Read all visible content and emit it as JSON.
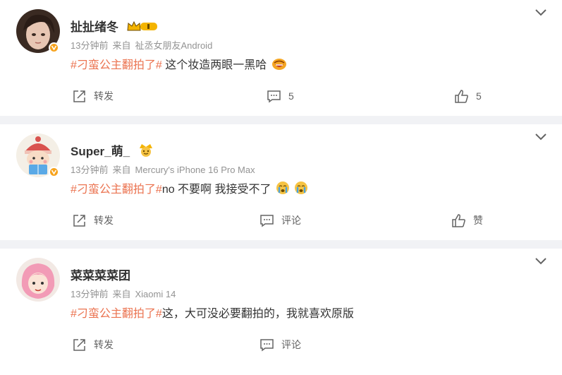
{
  "posts": [
    {
      "user": "扯扯绪冬",
      "time": "13分钟前",
      "source_prefix": "来自",
      "source": "祉丞女朋友Android",
      "hashtag": "#刁蛮公主翻拍了#",
      "text": " 这个妆造两眼一黑哈",
      "repost": "转发",
      "comments": "5",
      "likes": "5"
    },
    {
      "user": "Super_萌_",
      "time": "13分钟前",
      "source_prefix": "来自",
      "source": "Mercury's iPhone 16 Pro Max",
      "hashtag": "#刁蛮公主翻拍了#",
      "text": "no 不要啊 我接受不了",
      "repost": "转发",
      "comments": "评论",
      "likes": "赞"
    },
    {
      "user": "菜菜菜菜团",
      "time": "13分钟前",
      "source_prefix": "来自",
      "source": "Xiaomi 14",
      "hashtag": "#刁蛮公主翻拍了#",
      "text": "这，大可没必要翻拍的，我就喜欢原版",
      "repost": "转发",
      "comments": "评论"
    }
  ],
  "colors": {
    "hashtag": "#eb7350",
    "badge": "#f7a21b",
    "separator": "#f1f2f5"
  },
  "icons": [
    "chevron-down-icon",
    "repost-icon",
    "comment-icon",
    "like-icon",
    "verified-badge-icon",
    "crown-badge-icon",
    "laugh-emoji-icon",
    "crying-emoji-icon"
  ]
}
